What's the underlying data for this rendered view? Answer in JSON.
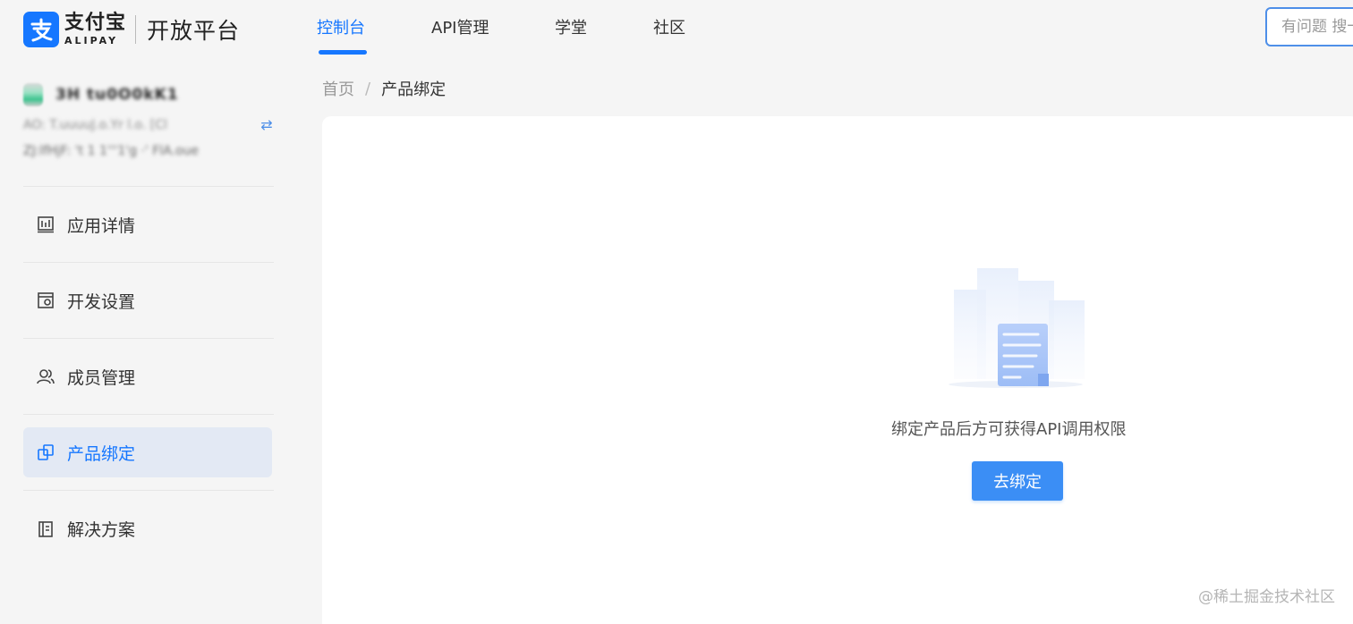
{
  "header": {
    "logo": {
      "cn": "支付宝",
      "en": "ALIPAY",
      "platform": "开放平台"
    },
    "nav": [
      {
        "label": "控制台",
        "active": true
      },
      {
        "label": "API管理",
        "active": false
      },
      {
        "label": "学堂",
        "active": false
      },
      {
        "label": "社区",
        "active": false
      }
    ],
    "search": {
      "placeholder": "有问题 搜一搜"
    }
  },
  "sidebar": {
    "account": {
      "name": "3H tu0O0kK1",
      "id": "AO: T.uuuuJ.o.Yr l.o. [Cl",
      "email": "ZJ:lfHjF: 't 1 1'''1'g ·' FlA.oue"
    },
    "menu": [
      {
        "label": "应用详情",
        "icon": "chart-icon",
        "active": false
      },
      {
        "label": "开发设置",
        "icon": "dev-settings-icon",
        "active": false
      },
      {
        "label": "成员管理",
        "icon": "members-icon",
        "active": false
      },
      {
        "label": "产品绑定",
        "icon": "link-icon",
        "active": true
      },
      {
        "label": "解决方案",
        "icon": "book-icon",
        "active": false
      }
    ]
  },
  "breadcrumb": {
    "home": "首页",
    "separator": "/",
    "current": "产品绑定"
  },
  "main": {
    "empty_text": "绑定产品后方可获得API调用权限",
    "bind_button": "去绑定"
  },
  "watermark": "@稀土掘金技术社区",
  "colors": {
    "accent": "#1677ff",
    "button": "#3b8ef5",
    "active_bg": "#e3e9f4"
  }
}
